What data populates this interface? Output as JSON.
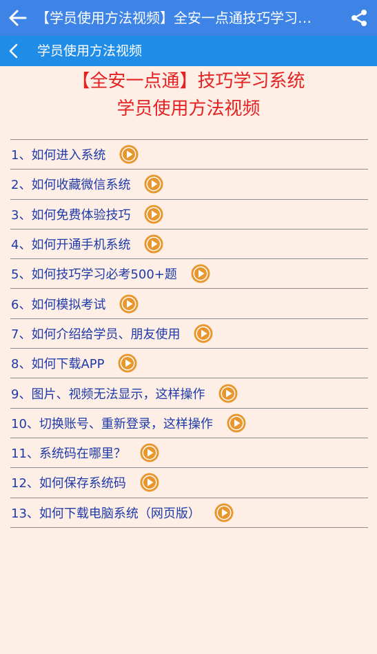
{
  "appbar": {
    "title": "【学员使用方法视频】全安一点通技巧学习…",
    "back_icon": "arrow-left-icon",
    "share_icon": "share-icon"
  },
  "subbar": {
    "title": "学员使用方法视频",
    "back_icon": "chevron-left-icon"
  },
  "heading": {
    "line1": "【全安一点通】技巧学习系统",
    "line2": "学员使用方法视频"
  },
  "items": [
    {
      "label": "1、如何进入系统"
    },
    {
      "label": "2、如何收藏微信系统"
    },
    {
      "label": "3、如何免费体验技巧"
    },
    {
      "label": "4、如何开通手机系统"
    },
    {
      "label": "5、如何技巧学习必考500+题"
    },
    {
      "label": "6、如何模拟考试"
    },
    {
      "label": "7、如何介绍给学员、朋友使用"
    },
    {
      "label": "8、如何下载APP"
    },
    {
      "label": "9、图片、视频无法显示，这样操作"
    },
    {
      "label": "10、切换账号、重新登录，这样操作"
    },
    {
      "label": "11、系统码在哪里？"
    },
    {
      "label": "12、如何保存系统码"
    },
    {
      "label": "13、如何下载电脑系统（网页版）"
    }
  ],
  "colors": {
    "appbar": "#3d84e6",
    "subbar": "#1f8de8",
    "background": "#fdeee6",
    "heading": "#e52222",
    "link": "#1e3aa8",
    "play_fill": "#e8962e"
  }
}
